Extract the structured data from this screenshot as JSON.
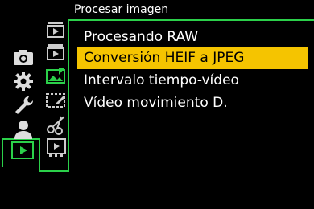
{
  "header": {
    "title": "Procesar imagen"
  },
  "menu": {
    "items": [
      {
        "label": "Procesando RAW",
        "selected": false
      },
      {
        "label": "Conversión HEIF a JPEG",
        "selected": true
      },
      {
        "label": "Intervalo tiempo-vídeo",
        "selected": false
      },
      {
        "label": "Vídeo movimiento D.",
        "selected": false
      }
    ]
  },
  "categories": [
    "camera-icon",
    "gear-icon",
    "wrench-icon",
    "person-icon",
    "playback-icon"
  ],
  "tabs": [
    "playback-stack-1-icon",
    "playback-stack-2-icon",
    "image-edit-icon",
    "image-frame-edit-icon",
    "scissors-icon",
    "film-playback-icon"
  ],
  "colors": {
    "accent": "#2bd04a",
    "highlight": "#f5c400"
  }
}
